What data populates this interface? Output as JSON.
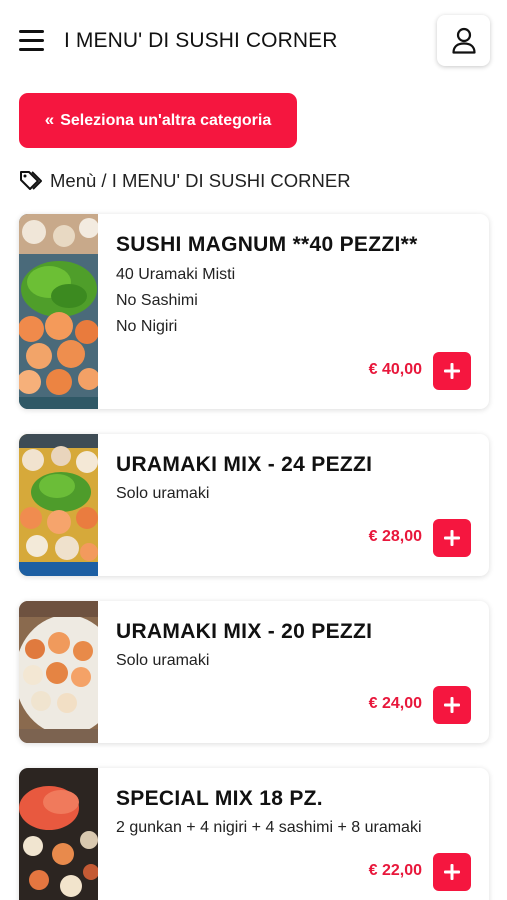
{
  "header": {
    "title": "I MENU' DI SUSHI CORNER"
  },
  "category_button": {
    "icon": "chevrons-left-icon",
    "label": "Seleziona un'altra categoria"
  },
  "breadcrumb": {
    "icon": "tags-icon",
    "text": "Menù / I MENU' DI SUSHI CORNER"
  },
  "colors": {
    "accent": "#f5163f",
    "price": "#e8173b"
  },
  "products": [
    {
      "name": "SUSHI MAGNUM **40 PEZZI**",
      "description": [
        "40 Uramaki Misti",
        "No Sashimi",
        "No Nigiri"
      ],
      "price": "€ 40,00"
    },
    {
      "name": "URAMAKI MIX - 24 PEZZI",
      "description": [
        "Solo uramaki"
      ],
      "price": "€ 28,00"
    },
    {
      "name": "URAMAKI MIX - 20 PEZZI",
      "description": [
        "Solo uramaki"
      ],
      "price": "€ 24,00"
    },
    {
      "name": "SPECIAL MIX 18 PZ.",
      "description": [
        "2 gunkan + 4 nigiri + 4 sashimi + 8 uramaki"
      ],
      "price": "€ 22,00"
    }
  ]
}
